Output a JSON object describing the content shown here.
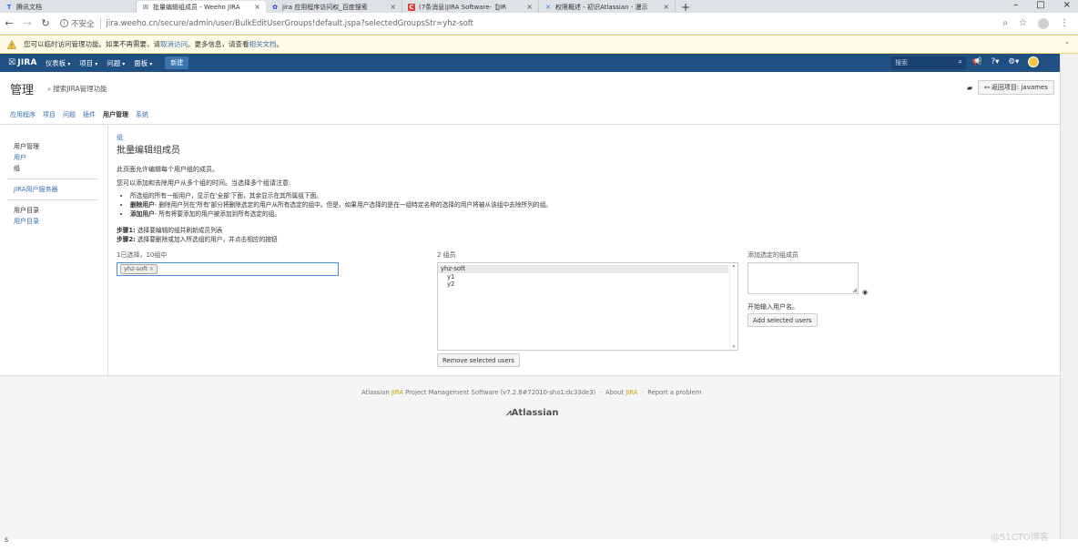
{
  "browser": {
    "tabs": [
      {
        "title": "腾讯文档",
        "active": false,
        "icon": "tencent-docs-icon"
      },
      {
        "title": "批量编辑组成员 - Weeho JIRA",
        "active": true,
        "icon": "jira-icon"
      },
      {
        "title": "jira 应用程序访问权_百度搜索",
        "active": false,
        "icon": "baidu-icon"
      },
      {
        "title": "(7条消息)JIRA Software-【JIR",
        "active": false,
        "icon": "csdn-icon"
      },
      {
        "title": "权限概述 - 初识Atlassian - 漫示",
        "active": false,
        "icon": "confluence-icon"
      }
    ],
    "new_tab": "+",
    "window_controls": {
      "minimize": "–",
      "maximize": "□",
      "close": "×"
    },
    "address": {
      "security_label": "不安全",
      "url": "jira.weeho.cn/secure/admin/user/BulkEditUserGroups!default.jspa?selectedGroupsStr=yhz-soft"
    }
  },
  "warning": {
    "text_before": "您可以临时访问管理功能。如果不再需要，请",
    "link1": "取消访问",
    "text_middle": "。更多信息，请查看",
    "link2": "相关文档",
    "text_after": "。"
  },
  "jira_header": {
    "logo": "JIRA",
    "nav": [
      "仪表板",
      "项目",
      "问题",
      "面板"
    ],
    "create_label": "新建",
    "search_placeholder": "搜索"
  },
  "admin": {
    "title": "管理",
    "search_label": "搜索JIRA管理功能",
    "back_button": "返回项目: javames",
    "tabs": [
      "应用程序",
      "项目",
      "问题",
      "插件",
      "用户管理",
      "系统"
    ],
    "current_tab": "用户管理"
  },
  "sidebar": {
    "section1": "用户管理",
    "item_users": "用户",
    "item_groups": "组",
    "item_jira_server": "JIRA用户服务器",
    "section2": "用户目录",
    "item_directory": "用户目录"
  },
  "main": {
    "breadcrumb": "组",
    "title": "批量编辑组成员",
    "desc1": "此页面允许编辑每个用户组的成员。",
    "desc2": "您可以添加和去除用户从多个组的时间。当选择多个组请注意:",
    "bullet1": "所选组的所有一般用户，显示在'全部'下面，其余显示在其所属组下面。",
    "bullet2_bold": "删除用户",
    "bullet2": "- 删除用户列在'所有'部分将删除选定的用户从所有选定的组中。但是，如果用户选择的是在一组特定名称的选择的用户将被从该组中去除所列的组。",
    "bullet3_bold": "添加用户",
    "bullet3": "- 所有将要添加的用户被添加到所有选定的组。",
    "step1_bold": "步骤1:",
    "step1": "选择要编辑的组并刷新成员列表",
    "step2_bold": "步骤2:",
    "step2": "选择要删除或加入所选组的用户，并点击相应的按钮",
    "groups_label": "1已选择，10组中",
    "selected_group": "yhz-soft",
    "members_label": "2 组员",
    "members_group": "yhz-soft",
    "members": [
      "y1",
      "y2"
    ],
    "remove_button": "Remove selected users",
    "add_label": "添加选定的组成员",
    "add_hint": "开始输入用户名。",
    "add_button": "Add selected users"
  },
  "footer": {
    "line_pre": "Atlassian",
    "line_jira": "JIRA",
    "line_mid": "Project Management Software (v7.2.8#72010-sha1:dc33de3)",
    "about": "About",
    "about_jira": "JIRA",
    "report": "Report a problem",
    "logo": "Atlassian"
  },
  "status": "s",
  "watermark": "@51CTO博客"
}
